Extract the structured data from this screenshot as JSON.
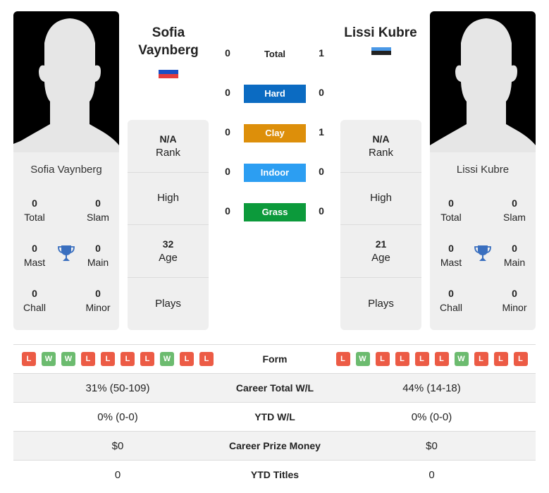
{
  "colors": {
    "win": "#6cbb6f",
    "loss": "#ec5b45",
    "hard": "#0b6bc2",
    "clay": "#dd8f0a",
    "indoor": "#2c9ef2",
    "grass": "#0c9a3b",
    "trophy": "#3a6fbf"
  },
  "player1": {
    "name": "Sofia Vaynberg",
    "name_line1": "Sofia",
    "name_line2": "Vaynberg",
    "flag": "russia-flag",
    "flag_colors": [
      "#ffffff",
      "#1b4fc4",
      "#e63c3c"
    ],
    "titles": {
      "total": "0",
      "slam": "0",
      "mast": "0",
      "main": "0",
      "chall": "0",
      "minor": "0"
    },
    "rank": "N/A",
    "rank_label": "Rank",
    "high_label": "High",
    "age": "32",
    "age_label": "Age",
    "plays_label": "Plays",
    "form": [
      "L",
      "W",
      "W",
      "L",
      "L",
      "L",
      "L",
      "W",
      "L",
      "L"
    ],
    "career_wl": "31% (50-109)",
    "ytd_wl": "0% (0-0)",
    "prize": "$0",
    "ytd_titles": "0"
  },
  "player2": {
    "name": "Lissi Kubre",
    "flag": "estonia-flag",
    "flag_colors": [
      "#4a98e6",
      "#222222",
      "#ffffff"
    ],
    "titles": {
      "total": "0",
      "slam": "0",
      "mast": "0",
      "main": "0",
      "chall": "0",
      "minor": "0"
    },
    "rank": "N/A",
    "rank_label": "Rank",
    "high_label": "High",
    "age": "21",
    "age_label": "Age",
    "plays_label": "Plays",
    "form": [
      "L",
      "W",
      "L",
      "L",
      "L",
      "L",
      "W",
      "L",
      "L",
      "L"
    ],
    "career_wl": "44% (14-18)",
    "ytd_wl": "0% (0-0)",
    "prize": "$0",
    "ytd_titles": "0"
  },
  "title_labels": {
    "total": "Total",
    "slam": "Slam",
    "mast": "Mast",
    "main": "Main",
    "chall": "Chall",
    "minor": "Minor"
  },
  "h2h": {
    "total": {
      "label": "Total",
      "p1": "0",
      "p2": "1"
    },
    "hard": {
      "label": "Hard",
      "p1": "0",
      "p2": "0"
    },
    "clay": {
      "label": "Clay",
      "p1": "0",
      "p2": "1"
    },
    "indoor": {
      "label": "Indoor",
      "p1": "0",
      "p2": "0"
    },
    "grass": {
      "label": "Grass",
      "p1": "0",
      "p2": "0"
    }
  },
  "table": {
    "form_label": "Form",
    "career_label": "Career Total W/L",
    "ytd_label": "YTD W/L",
    "prize_label": "Career Prize Money",
    "titles_label": "YTD Titles"
  }
}
